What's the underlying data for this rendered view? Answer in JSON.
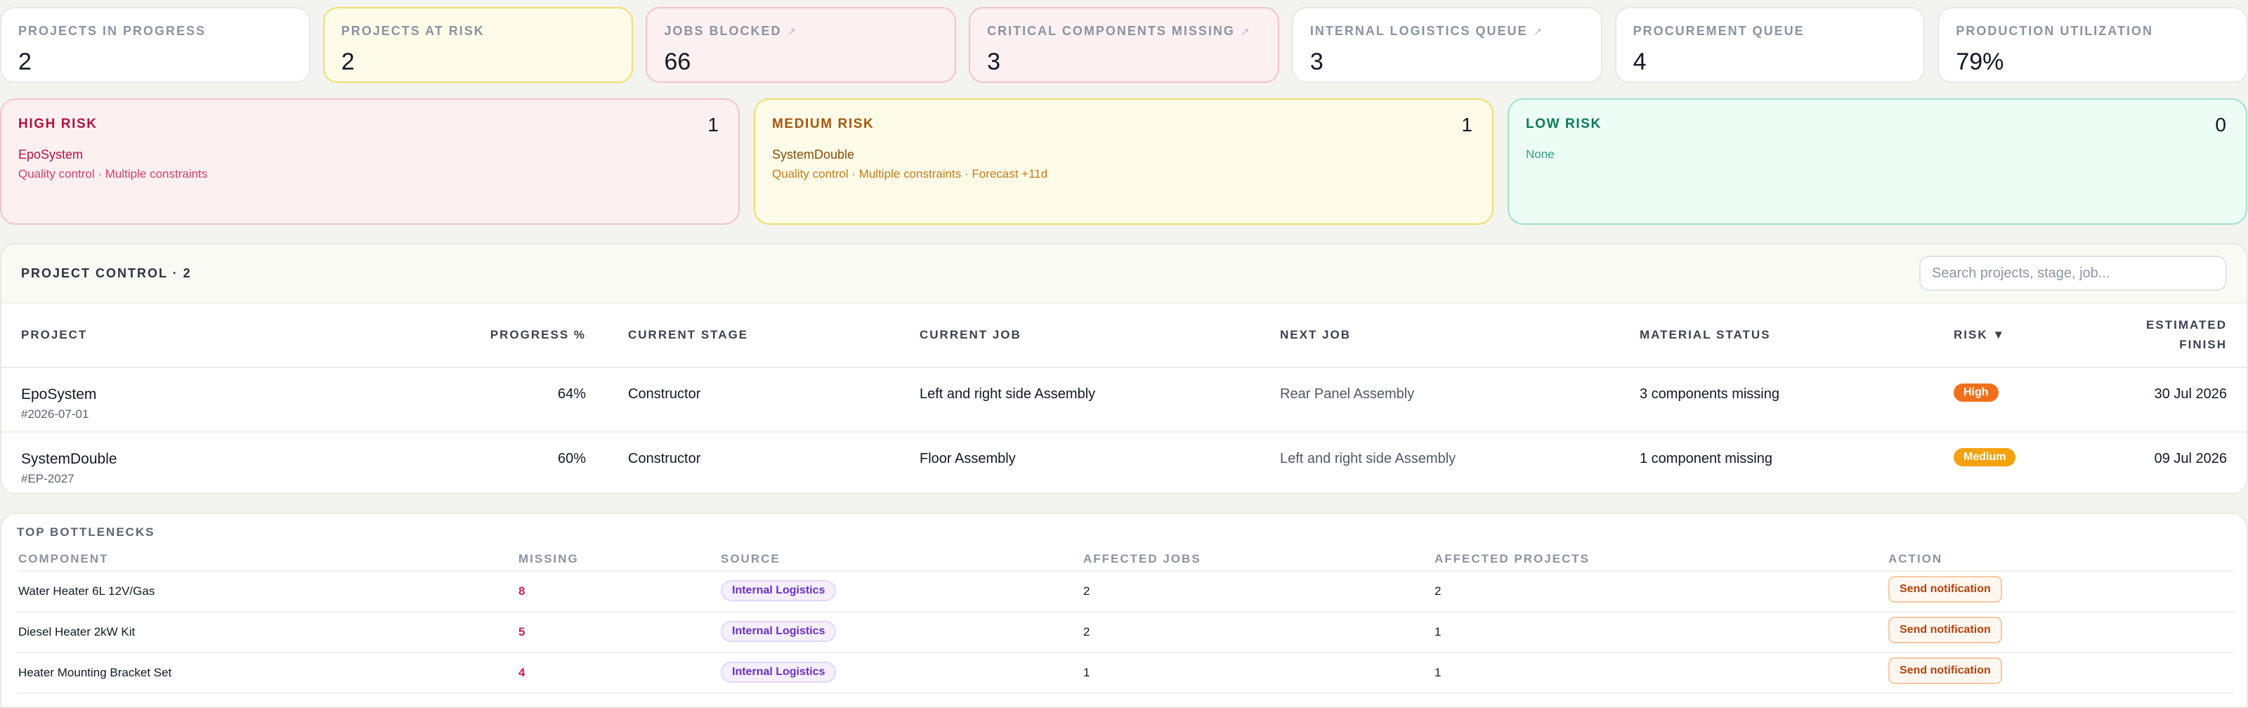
{
  "kpis": [
    {
      "label": "Projects in progress",
      "value": "2",
      "tone": "neutral",
      "external": false
    },
    {
      "label": "Projects at risk",
      "value": "2",
      "tone": "warn",
      "external": false
    },
    {
      "label": "Jobs blocked",
      "value": "66",
      "tone": "danger",
      "external": true
    },
    {
      "label": "Critical components missing",
      "value": "3",
      "tone": "danger",
      "external": true
    },
    {
      "label": "Internal logistics queue",
      "value": "3",
      "tone": "neutral",
      "external": true
    },
    {
      "label": "Procurement queue",
      "value": "4",
      "tone": "neutral",
      "external": false
    },
    {
      "label": "Production utilization",
      "value": "79%",
      "tone": "neutral",
      "external": false
    }
  ],
  "risk": {
    "high": {
      "title": "High risk",
      "count": "1",
      "project": "EpoSystem",
      "meta": "Quality control · Multiple constraints"
    },
    "medium": {
      "title": "Medium risk",
      "count": "1",
      "project": "SystemDouble",
      "meta": "Quality control · Multiple constraints · Forecast +11d"
    },
    "low": {
      "title": "Low risk",
      "count": "0",
      "project": "",
      "meta": "None"
    }
  },
  "control": {
    "title": "Project control · 2",
    "search_placeholder": "Search projects, stage, job...",
    "columns": {
      "project": "Project",
      "progress": "Progress %",
      "stage": "Current stage",
      "job": "Current job",
      "next": "Next job",
      "material": "Material status",
      "risk": "Risk ▼",
      "finish": "Estimated finish"
    },
    "rows": [
      {
        "name": "EpoSystem",
        "code": "#2026-07-01",
        "progress": "64%",
        "stage": "Constructor",
        "job": "Left and right side Assembly",
        "next": "Rear Panel Assembly",
        "material": "3 components missing",
        "risk": "High",
        "finish": "30 Jul 2026"
      },
      {
        "name": "SystemDouble",
        "code": "#EP-2027",
        "progress": "60%",
        "stage": "Constructor",
        "job": "Floor Assembly",
        "next": "Left and right side Assembly",
        "material": "1 component missing",
        "risk": "Medium",
        "finish": "09 Jul 2026"
      }
    ]
  },
  "bottlenecks": {
    "title": "Top bottlenecks",
    "columns": {
      "component": "Component",
      "missing": "Missing",
      "source": "Source",
      "jobs": "Affected jobs",
      "projects": "Affected projects",
      "action": "Action"
    },
    "rows": [
      {
        "component": "Water Heater 6L 12V/Gas",
        "missing": "8",
        "source": "Internal Logistics",
        "jobs": "2",
        "projects": "2",
        "action": "Send notification"
      },
      {
        "component": "Diesel Heater 2kW Kit",
        "missing": "5",
        "source": "Internal Logistics",
        "jobs": "2",
        "projects": "1",
        "action": "Send notification"
      },
      {
        "component": "Heater Mounting Bracket Set",
        "missing": "4",
        "source": "Internal Logistics",
        "jobs": "1",
        "projects": "1",
        "action": "Send notification"
      }
    ]
  },
  "icons": {
    "external": "external-link-icon",
    "sort": "sort-down-icon"
  },
  "colors": {
    "high": "#f1701c",
    "medium": "#f4a20d",
    "danger_text": "#b4123e",
    "chip": "#6b2fc4"
  }
}
